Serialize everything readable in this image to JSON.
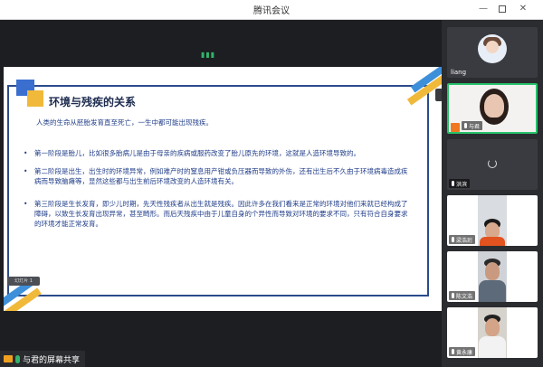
{
  "window": {
    "title": "腾讯会议",
    "minimize_label": "—",
    "close_label": "✕"
  },
  "slide": {
    "title": "环境与残疾的关系",
    "intro": "人类的生命从胚胎发育直至死亡，一生中都可能出现残疾。",
    "bullets": [
      "第一阶段是胎儿，比如很多胎病儿是由于母亲的疾病或服药改变了胎儿原先的环境，这就是人造环境导致的。",
      "第二阶段是出生，出生时的环境异常，例如难产时的窒息用产钳或负压器而导致的外伤，还有出生后不久由于环境病毒造成疾病而导致脑瘫等，显然这些都与出生前后环境改变的人造环境有关。",
      "第三阶段是生长发育，即少儿时期，先天性残疾者从出生就是残疾。因此许多在我们看来是正常的环境对他们来就已经构成了障碍，以致生长发育出现异常，甚至畸形。而后天残疾中由于儿童自身的个异性而导致对环境的要求不同，只有符合自身要求的环境才能正常发育。"
    ],
    "bullet_marker": "•",
    "tag_text": "幻灯片 1"
  },
  "share": {
    "label": "与君的屏幕共享"
  },
  "participants": [
    {
      "name": "liang",
      "type": "avatar"
    },
    {
      "name": "与君",
      "type": "video"
    },
    {
      "name": "洪滨",
      "type": "loading"
    },
    {
      "name": "梁浩珩",
      "type": "video"
    },
    {
      "name": "陈文浩",
      "type": "video"
    },
    {
      "name": "黄永康",
      "type": "video"
    }
  ],
  "colors": {
    "accent_blue": "#2b4c8c",
    "accent_yellow": "#f0b93a",
    "active_border": "#27c26a"
  }
}
